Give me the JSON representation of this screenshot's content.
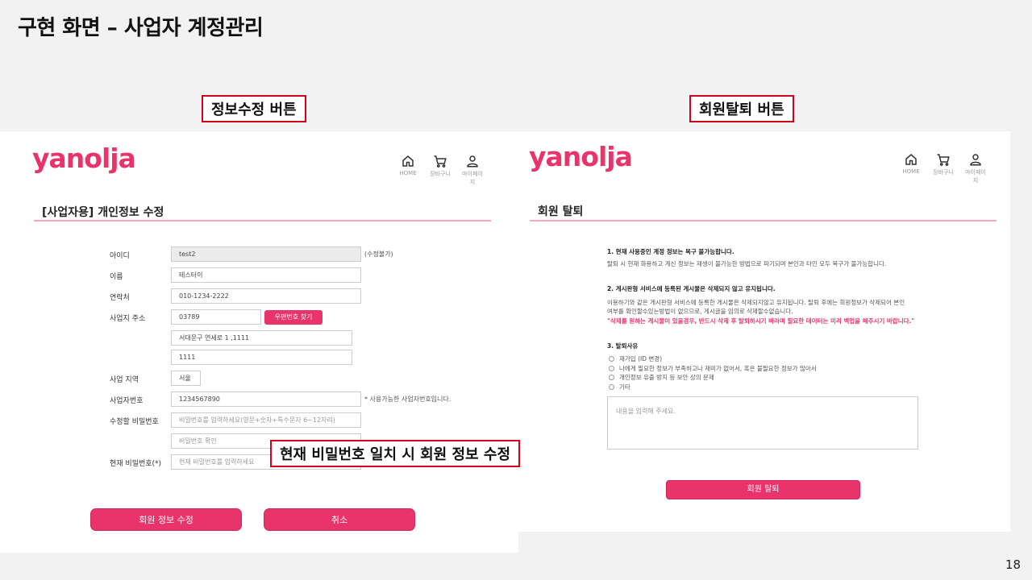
{
  "slide": {
    "title": "구현 화면 – 사업자 계정관리",
    "page_number": "18",
    "callouts": {
      "edit_button": "정보수정 버튼",
      "withdraw_button": "회원탈퇴 버튼",
      "password_note": "현재 비밀번호 일치 시 회원 정보 수정"
    }
  },
  "brand": {
    "logo": "yanolja",
    "accent_color": "#e8336b"
  },
  "left": {
    "nav": [
      {
        "label": "HOME",
        "icon": "home-icon"
      },
      {
        "label": "장바구니",
        "icon": "cart-icon"
      },
      {
        "label": "마이페이지",
        "icon": "user-icon"
      }
    ],
    "section_title": "[사업자용] 개인정보 수정",
    "labels": {
      "id": "아이디",
      "name": "이름",
      "phone": "연락처",
      "address": "사업지 주소",
      "region": "사업 지역",
      "biz_number": "사업자번호",
      "new_password": "수정할 비밀번호",
      "current_password": "현재 비밀번호(*)"
    },
    "values": {
      "id": "test2",
      "id_note": "(수정불가)",
      "name": "테스터이",
      "phone": "010-1234-2222",
      "zipcode": "03789",
      "zip_button": "우편번호 찾기",
      "address1": "서대문구 연세로 1 ,1111",
      "address2": "1111",
      "region": "서울",
      "biz_number": "1234567890",
      "biz_note": "* 사용가능한 사업자번호입니다."
    },
    "placeholders": {
      "new_password": "비밀번호를 입력하세요(영문+숫자+특수문자 6~12자리)",
      "confirm_password": "비밀번호 확인",
      "current_password": "현재 비밀번호를 입력하세요"
    },
    "buttons": {
      "submit": "회원 정보 수정",
      "cancel": "취소"
    }
  },
  "right": {
    "nav": [
      {
        "label": "HOME",
        "icon": "home-icon"
      },
      {
        "label": "장바구니",
        "icon": "cart-icon"
      },
      {
        "label": "마이페이지",
        "icon": "user-icon"
      }
    ],
    "section_title": "회원 탈퇴",
    "notice1_title": "1.  현재 사용중인 계정 정보는 복구 불가능합니다.",
    "notice1_body": "탈퇴 시 현재 화용하고 계신 정보는 재생이 불가능한 방법으로 파기되며 본인과 타인 모두 복구가 불가능합니다.",
    "notice2_title": "2.  게시판형 서비스에 등록된 게시물은 삭제되지 않고 유지됩니다.",
    "notice2_body1": "이용하기와 같은 게시판형 서비스에 등록한 게시물은 삭제되지않고 유지됩니다. 탈퇴 후에는 회원정보가 삭제되어 본인",
    "notice2_body2": "여부를 확인할수있는방법이 없으므로, 게시글을 임의로 삭제할수없습니다.",
    "notice2_warning": "\"삭제를 원하는 게시물이 있을경우, 반드시 삭제 후 탈퇴하시기 바라며 필요한 데이터는 미리 백업을 해주시기 바랍니다.\"",
    "reason_title": "3.  탈퇴사유",
    "reasons": [
      "재가입 (ID 변경)",
      "나에게 필요한 정보가 부족하고나 재미가 없어서, 혹은 불필요한 정보가 많아서",
      "개인정보 유출 방지 등 보안 상의 문제",
      "기타"
    ],
    "textarea_placeholder": "내용을 입력해 주세요.",
    "withdraw_button": "회원 탈퇴"
  }
}
